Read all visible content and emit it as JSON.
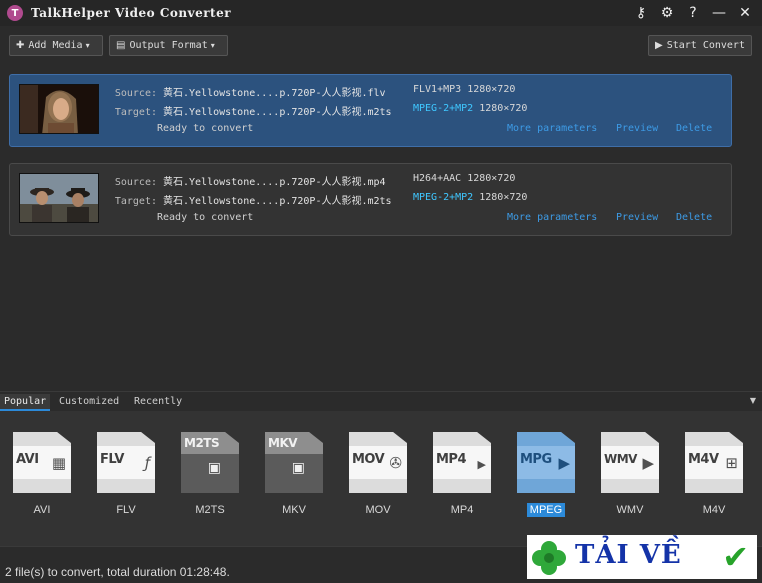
{
  "app": {
    "title": "TalkHelper Video Converter",
    "logo_letter": "T"
  },
  "window_controls": [
    {
      "name": "key-icon",
      "glyph": "⚷"
    },
    {
      "name": "gear-icon",
      "glyph": "⚙"
    },
    {
      "name": "help-icon",
      "glyph": "?"
    },
    {
      "name": "minimize-icon",
      "glyph": "—"
    },
    {
      "name": "close-icon",
      "glyph": "✕"
    }
  ],
  "toolbar": {
    "add_media": "Add Media",
    "output_format": "Output Format",
    "start_convert": "Start Convert"
  },
  "files": [
    {
      "source_label": "Source:",
      "target_label": "Target:",
      "source_name": "黄石.Yellowstone....p.720P-人人影视.flv",
      "source_codec": "FLV1+MP3",
      "source_res": "1280×720",
      "target_name": "黄石.Yellowstone....p.720P-人人影视.m2ts",
      "target_codec": "MPEG-2+MP2",
      "target_res": "1280×720",
      "status": "Ready to convert",
      "more": "More parameters",
      "preview": "Preview",
      "delete": "Delete",
      "selected": true
    },
    {
      "source_label": "Source:",
      "target_label": "Target:",
      "source_name": "黄石.Yellowstone....p.720P-人人影视.mp4",
      "source_codec": "H264+AAC",
      "source_res": "1280×720",
      "target_name": "黄石.Yellowstone....p.720P-人人影视.m2ts",
      "target_codec": "MPEG-2+MP2",
      "target_res": "1280×720",
      "status": "Ready to convert",
      "more": "More parameters",
      "preview": "Preview",
      "delete": "Delete",
      "selected": false
    }
  ],
  "format_tabs": [
    "Popular",
    "Customized",
    "Recently"
  ],
  "formats": [
    {
      "icon_text": "AVI",
      "label": "AVI",
      "glyph": "▦"
    },
    {
      "icon_text": "FLV",
      "label": "FLV",
      "glyph": "ƒ"
    },
    {
      "icon_text": "M2TS",
      "label": "M2TS",
      "glyph": "▣"
    },
    {
      "icon_text": "MKV",
      "label": "MKV",
      "glyph": "▣"
    },
    {
      "icon_text": "MOV",
      "label": "MOV",
      "glyph": "✇"
    },
    {
      "icon_text": "MP4",
      "label": "MP4",
      "glyph": "▶"
    },
    {
      "icon_text": "MPG",
      "label": "MPEG",
      "glyph": "▶"
    },
    {
      "icon_text": "WMV",
      "label": "WMV",
      "glyph": "▶"
    },
    {
      "icon_text": "M4V",
      "label": "M4V",
      "glyph": "⊞"
    }
  ],
  "status_bar": {
    "text": "2 file(s) to convert, total duration 01:28:48."
  },
  "watermark": {
    "text": "TẢI VỀ"
  },
  "colors": {
    "accent": "#2c8ad9",
    "selected_row": "#2c527e",
    "link": "#3d9be6",
    "codec_highlight": "#3fc7ff"
  }
}
